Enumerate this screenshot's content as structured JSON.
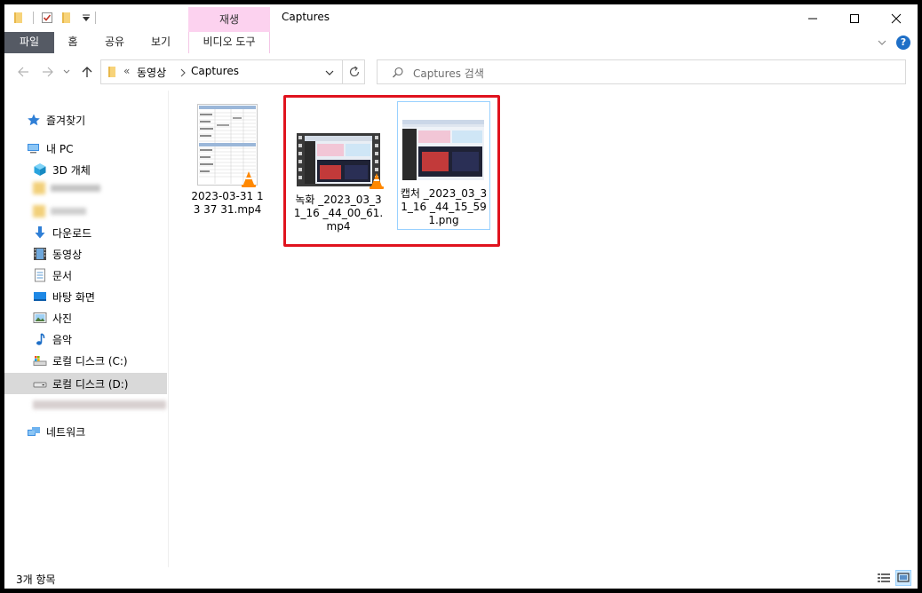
{
  "window": {
    "title": "Captures",
    "context_tab_header": "재생",
    "controls": {
      "minimize": "—",
      "maximize": "☐",
      "close": "✕"
    }
  },
  "ribbon": {
    "tabs": [
      {
        "label": "파일"
      },
      {
        "label": "홈"
      },
      {
        "label": "공유"
      },
      {
        "label": "보기"
      },
      {
        "label": "비디오 도구"
      }
    ],
    "help": "?"
  },
  "address": {
    "path": [
      "동영상",
      "Captures"
    ],
    "overflow": "«",
    "search_placeholder": "Captures 검색"
  },
  "nav": {
    "items": [
      {
        "label": "즐겨찾기",
        "icon": "star-icon"
      },
      {
        "label": "내 PC",
        "icon": "pc-icon"
      },
      {
        "label": "3D 개체",
        "icon": "cube-icon"
      },
      {
        "label": "다운로드",
        "icon": "download-icon"
      },
      {
        "label": "동영상",
        "icon": "film-icon"
      },
      {
        "label": "문서",
        "icon": "document-icon"
      },
      {
        "label": "바탕 화면",
        "icon": "desktop-icon"
      },
      {
        "label": "사진",
        "icon": "picture-icon"
      },
      {
        "label": "음악",
        "icon": "music-icon"
      },
      {
        "label": "로컬 디스크 (C:)",
        "icon": "drive-c-icon"
      },
      {
        "label": "로컬 디스크 (D:)",
        "icon": "drive-icon"
      },
      {
        "label": "네트워크",
        "icon": "network-icon"
      }
    ]
  },
  "files": [
    {
      "name": "2023-03-31 13 37 31.mp4",
      "type": "video"
    },
    {
      "name": "녹화 _2023_03_31_16 _44_00_61.mp4",
      "type": "video"
    },
    {
      "name": "캡처 _2023_03_31_16 _44_15_591.png",
      "type": "image"
    }
  ],
  "status": {
    "item_count": "3개 항목"
  },
  "colors": {
    "highlight": "#e0131e",
    "selected_border": "#99d1ff",
    "file_tab": "#555a64",
    "context_tab": "#fcd2ef"
  }
}
